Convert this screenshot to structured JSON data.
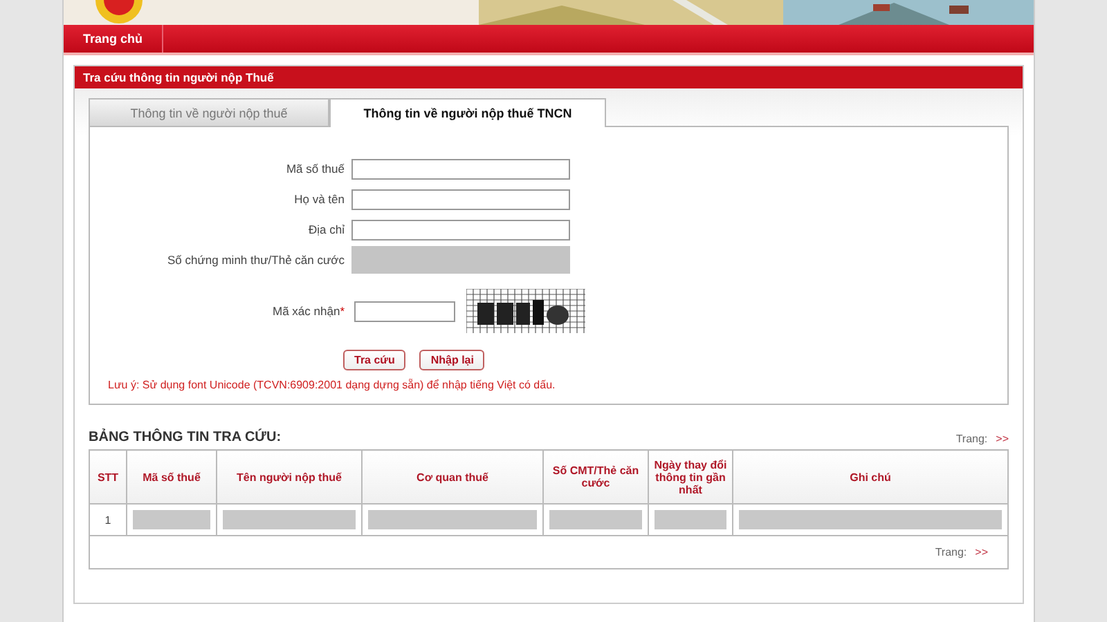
{
  "nav": {
    "items": [
      {
        "label": "Trang chủ"
      }
    ]
  },
  "panel": {
    "title": "Tra cứu thông tin người nộp Thuế"
  },
  "tabs": [
    {
      "label": "Thông tin về người nộp thuế",
      "selected": false
    },
    {
      "label": "Thông tin về người nộp thuế TNCN",
      "selected": true
    }
  ],
  "form": {
    "fields": [
      {
        "label": "Mã số thuế",
        "disabled": false
      },
      {
        "label": "Họ và tên",
        "disabled": false
      },
      {
        "label": "Địa chỉ",
        "disabled": false
      },
      {
        "label": "Số chứng minh thư/Thẻ căn cước",
        "disabled": true
      }
    ],
    "captcha": {
      "label": "Mã xác nhận",
      "required_mark": "*"
    },
    "buttons": [
      "Tra cứu",
      "Nhập lại"
    ],
    "note": "Lưu ý: Sử dụng font Unicode (TCVN:6909:2001 dạng dựng sẵn) để nhập tiếng Việt có dấu."
  },
  "results": {
    "title": "BẢNG THÔNG TIN TRA CỨU:",
    "pager_top": {
      "label": "Trang:",
      "next": ">>"
    },
    "columns": [
      "STT",
      "Mã số thuế",
      "Tên người nộp thuế",
      "Cơ quan thuế",
      "Số CMT/Thẻ căn cước",
      "Ngày thay đổi thông tin gần nhất",
      "Ghi chú"
    ],
    "rows": [
      {
        "cells": [
          {
            "kind": "text",
            "text": "1"
          },
          {
            "kind": "redacted"
          },
          {
            "kind": "redacted"
          },
          {
            "kind": "redacted"
          },
          {
            "kind": "redacted"
          },
          {
            "kind": "redacted"
          },
          {
            "kind": "redacted"
          }
        ]
      }
    ],
    "pager_bottom": {
      "label": "Trang:",
      "next": ">>"
    }
  }
}
